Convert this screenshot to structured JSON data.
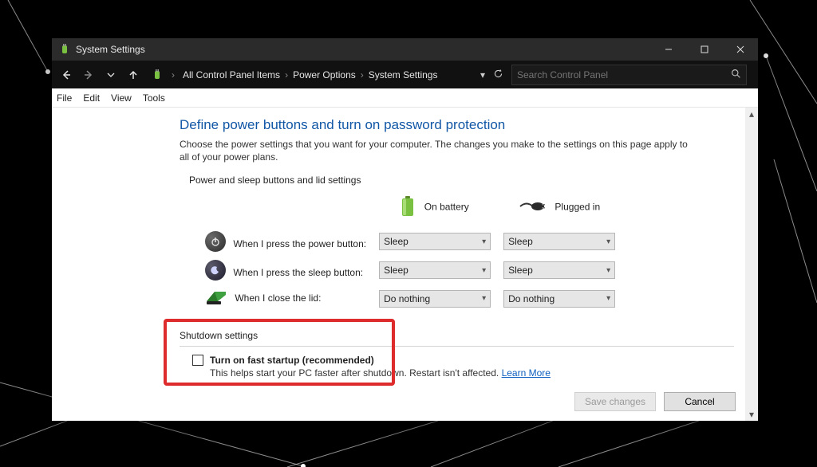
{
  "window": {
    "title": "System Settings"
  },
  "breadcrumb": {
    "items": [
      "All Control Panel Items",
      "Power Options",
      "System Settings"
    ]
  },
  "search": {
    "placeholder": "Search Control Panel"
  },
  "menubar": {
    "items": [
      "File",
      "Edit",
      "View",
      "Tools"
    ]
  },
  "page": {
    "heading": "Define power buttons and turn on password protection",
    "subtitle": "Choose the power settings that you want for your computer. The changes you make to the settings on this page apply to all of your power plans.",
    "section1_label": "Power and sleep buttons and lid settings",
    "col_battery": "On battery",
    "col_plugged": "Plugged in",
    "rows": [
      {
        "label": "When I press the power button:",
        "battery": "Sleep",
        "plugged": "Sleep"
      },
      {
        "label": "When I press the sleep button:",
        "battery": "Sleep",
        "plugged": "Sleep"
      },
      {
        "label": "When I close the lid:",
        "battery": "Do nothing",
        "plugged": "Do nothing"
      }
    ],
    "shutdown": {
      "title": "Shutdown settings",
      "checkbox_label": "Turn on fast startup (recommended)",
      "checkbox_checked": false,
      "help_text": "This helps start your PC faster after shutdown. Restart isn't affected. ",
      "learn_more": "Learn More"
    },
    "buttons": {
      "save": "Save changes",
      "cancel": "Cancel"
    }
  }
}
